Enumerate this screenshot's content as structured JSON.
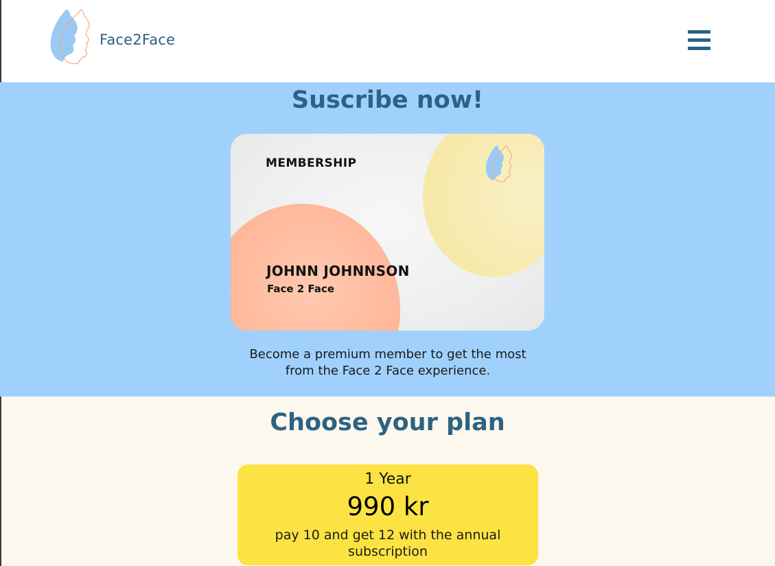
{
  "header": {
    "brand": "Face2Face",
    "logo_icon": "face-profile-icon",
    "menu_icon": "hamburger-menu-icon"
  },
  "hero": {
    "title": "Suscribe now!",
    "card": {
      "label": "MEMBERSHIP",
      "name": "JOHNN JOHNNSON",
      "subtitle": "Face 2 Face",
      "logo_icon": "face-profile-icon"
    },
    "description": "Become a premium member to get the most from the Face 2 Face experience."
  },
  "plans": {
    "title": "Choose your plan",
    "items": [
      {
        "period": "1 Year",
        "price": "990 kr",
        "description": "pay 10 and get 12 with the annual subscription"
      }
    ]
  },
  "colors": {
    "primary": "#2d6282",
    "hero_background": "#a0d1fd",
    "page_background": "#fdf8ee",
    "plan_card": "#fce343",
    "card_yellow_circle": "#f7ebb0",
    "card_orange_circle": "#ffb79a"
  }
}
